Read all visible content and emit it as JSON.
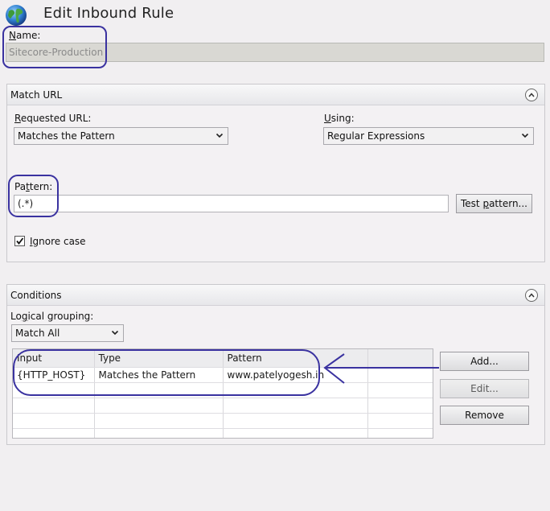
{
  "header": {
    "title": "Edit Inbound Rule"
  },
  "name": {
    "label_prefix": "N",
    "label_rest": "ame:",
    "value": "Sitecore-Production"
  },
  "match_url": {
    "section_title": "Match URL",
    "requested_url_label_prefix": "R",
    "requested_url_label_rest": "equested URL:",
    "requested_url_value": "Matches the Pattern",
    "using_label_prefix": "U",
    "using_label_rest": "sing:",
    "using_value": "Regular Expressions",
    "pattern_label_prefix": "Pa",
    "pattern_label_u": "t",
    "pattern_label_rest": "tern:",
    "pattern_value": "(.*)",
    "test_pattern_prefix": "Test ",
    "test_pattern_u": "p",
    "test_pattern_rest": "attern...",
    "ignore_case_prefix": "I",
    "ignore_case_rest": "gnore case",
    "ignore_case_checked": true
  },
  "conditions": {
    "section_title": "Conditions",
    "logical_grouping_label_prefix": "Lo",
    "logical_grouping_label_u": "g",
    "logical_grouping_label_rest": "ical grouping:",
    "logical_grouping_value": "Match All",
    "columns": [
      "Input",
      "Type",
      "Pattern",
      ""
    ],
    "rows": [
      [
        "{HTTP_HOST}",
        "Matches the Pattern",
        "www.patelyogesh.in",
        ""
      ]
    ],
    "add_label": "Add...",
    "edit_label": "Edit...",
    "remove_label": "Remove"
  },
  "colors": {
    "annotation": "#3a32a0",
    "background": "#f1eff1"
  }
}
